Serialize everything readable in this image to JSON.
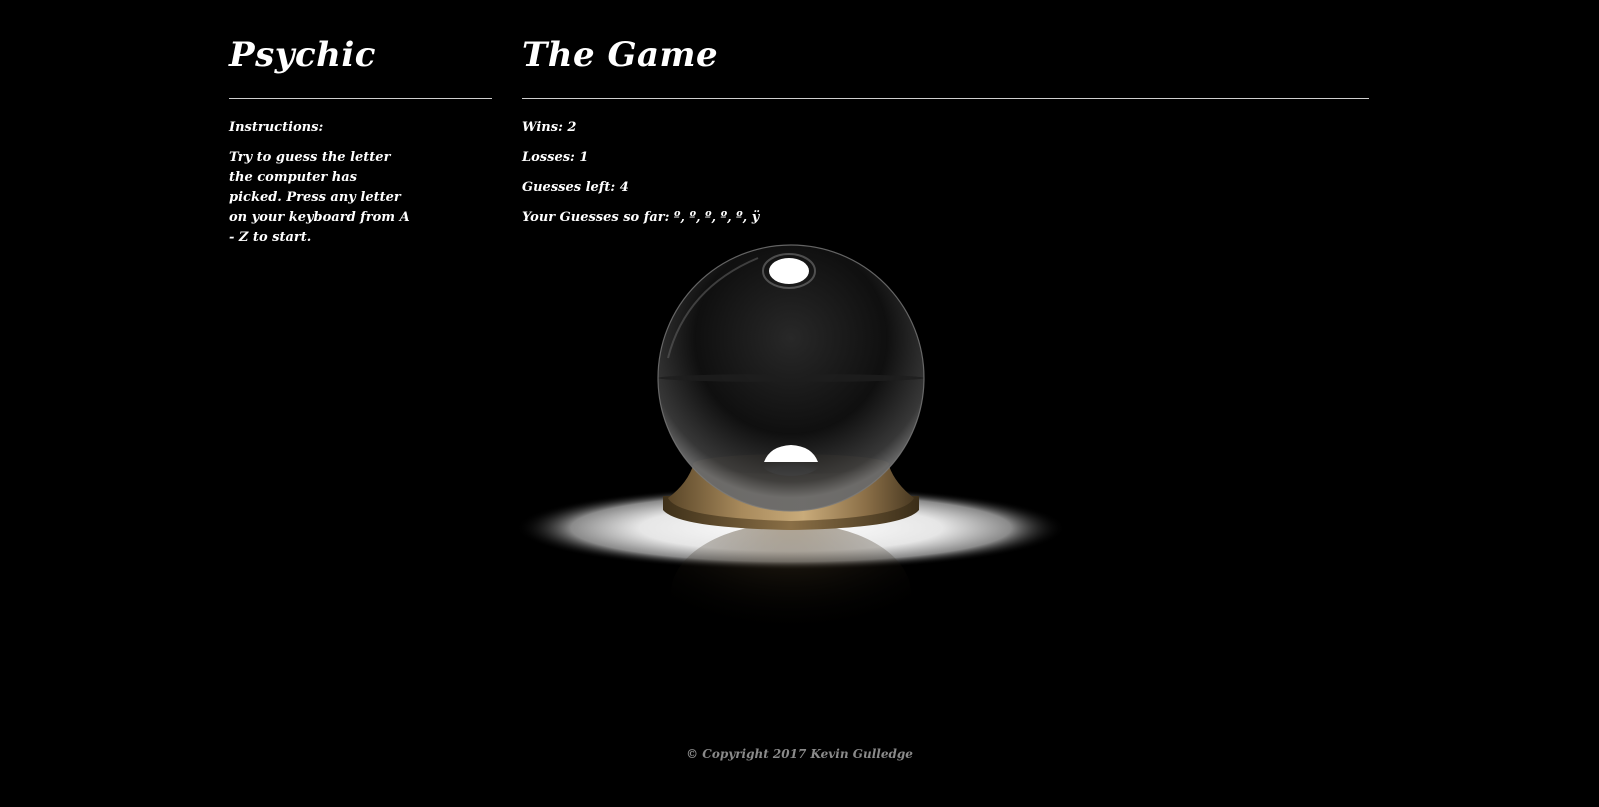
{
  "sidebar": {
    "title": "Psychic",
    "instructions_label": "Instructions:",
    "instructions_text": "Try to guess the letter the computer has picked. Press any letter on your keyboard from A - Z to start."
  },
  "game": {
    "title": "The Game",
    "wins": "Wins: 2",
    "losses": "Losses: 1",
    "guesses_left": "Guesses left: 4",
    "guesses_so_far": "Your Guesses so far: º, º, º, º, º, ÿ"
  },
  "image": {
    "icon": "crystal-ball-image"
  },
  "footer": {
    "copyright": "© Copyright 2017 Kevin Gulledge"
  },
  "colors": {
    "background": "#000000",
    "text": "#ffffff",
    "rule": "#cfcfcf",
    "footer_text": "#8a8a8a",
    "brass": "#a88a5c"
  }
}
